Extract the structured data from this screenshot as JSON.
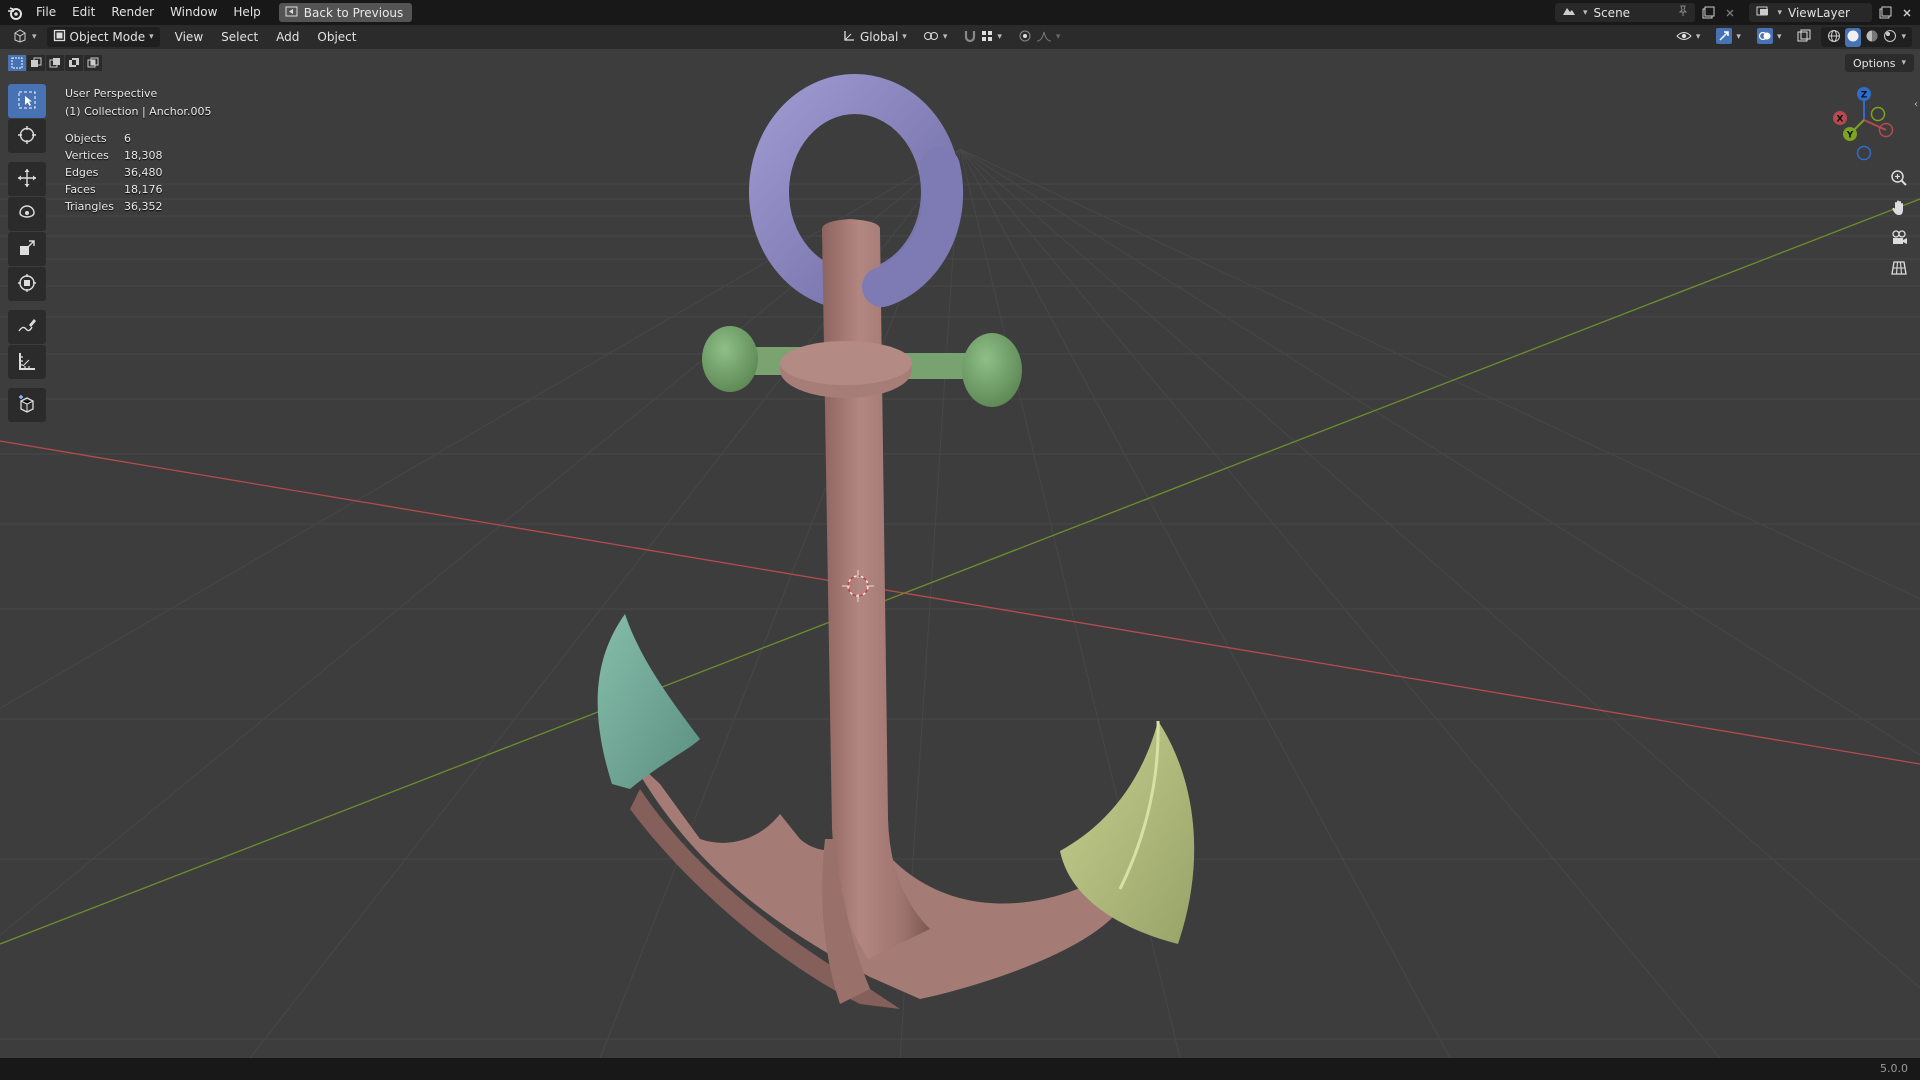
{
  "menu": {
    "items": [
      "File",
      "Edit",
      "Render",
      "Window",
      "Help"
    ],
    "back_button": "Back to Previous"
  },
  "workspace": {
    "scene_name": "Scene",
    "view_layer": "ViewLayer"
  },
  "header": {
    "mode": "Object Mode",
    "menus": [
      "View",
      "Select",
      "Add",
      "Object"
    ],
    "transform_orientation": "Global"
  },
  "viewport": {
    "perspective_label": "User Perspective",
    "collection_label": "(1) Collection | Anchor.005",
    "options_label": "Options",
    "stats": [
      {
        "label": "Objects",
        "value": "6"
      },
      {
        "label": "Vertices",
        "value": "18,308"
      },
      {
        "label": "Edges",
        "value": "36,480"
      },
      {
        "label": "Faces",
        "value": "18,176"
      },
      {
        "label": "Triangles",
        "value": "36,352"
      }
    ],
    "gizmo_axes": {
      "x": "X",
      "y": "Y",
      "z": "Z"
    }
  },
  "colors": {
    "accent": "#4772b3",
    "anchor_shank": "#a87e78",
    "ring": "#8a86bf",
    "stock": "#77a06e",
    "left_fluke": "#6ea595",
    "right_fluke": "#b3bd7c",
    "x_axis": "#b64b4f",
    "y_axis": "#6c8f2e"
  },
  "status": {
    "version": "5.0.0"
  }
}
